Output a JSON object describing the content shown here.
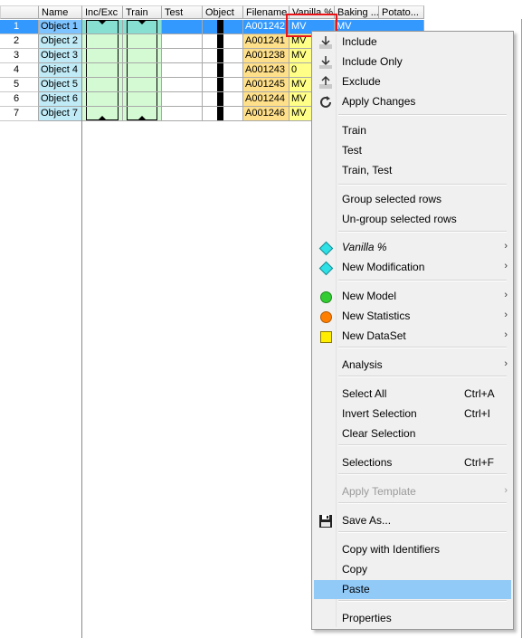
{
  "grid": {
    "headers": [
      "",
      "Name",
      "Inc/Exc",
      "Train",
      "Test",
      "Object",
      "Filename",
      "Vanilla %",
      "Baking ...",
      "Potato..."
    ],
    "rows": [
      {
        "num": "1",
        "name": "Object 1",
        "filename": "A001242",
        "vanilla": "MV"
      },
      {
        "num": "2",
        "name": "Object 2",
        "filename": "A001241",
        "vanilla": "MV"
      },
      {
        "num": "3",
        "name": "Object 3",
        "filename": "A001238",
        "vanilla": "MV"
      },
      {
        "num": "4",
        "name": "Object 4",
        "filename": "A001243",
        "vanilla": "0"
      },
      {
        "num": "5",
        "name": "Object 5",
        "filename": "A001245",
        "vanilla": "MV"
      },
      {
        "num": "6",
        "name": "Object 6",
        "filename": "A001244",
        "vanilla": "MV"
      },
      {
        "num": "7",
        "name": "Object 7",
        "filename": "A001246",
        "vanilla": "MV"
      }
    ],
    "selected_row": 1,
    "peek_text": "MV"
  },
  "menu": {
    "items": [
      {
        "label": "Include",
        "icon": "include-arrow-icon"
      },
      {
        "label": "Include Only",
        "icon": "include-only-arrow-icon"
      },
      {
        "label": "Exclude",
        "icon": "exclude-arrow-icon"
      },
      {
        "label": "Apply Changes",
        "icon": "refresh-icon"
      },
      {
        "label": "Train"
      },
      {
        "label": "Test"
      },
      {
        "label": "Train, Test"
      },
      {
        "label": "Group selected rows"
      },
      {
        "label": "Un-group selected rows"
      },
      {
        "label": "Vanilla %",
        "icon": "cyan-diamond-icon",
        "submenu": true
      },
      {
        "label": "New Modification",
        "icon": "cyan-diamond-icon",
        "submenu": true
      },
      {
        "label": "New Model",
        "icon": "green-circle-icon",
        "submenu": true
      },
      {
        "label": "New Statistics",
        "icon": "orange-circle-icon",
        "submenu": true
      },
      {
        "label": "New DataSet",
        "icon": "yellow-square-icon",
        "submenu": true
      },
      {
        "label": "Analysis",
        "submenu": true
      },
      {
        "label": "Select All",
        "shortcut": "Ctrl+A"
      },
      {
        "label": "Invert Selection",
        "shortcut": "Ctrl+I"
      },
      {
        "label": "Clear Selection"
      },
      {
        "label": "Selections",
        "shortcut": "Ctrl+F"
      },
      {
        "label": "Apply Template",
        "submenu": true,
        "disabled": true
      },
      {
        "label": "Save As...",
        "icon": "floppy-disk-icon"
      },
      {
        "label": "Copy with Identifiers"
      },
      {
        "label": "Copy"
      },
      {
        "label": "Paste",
        "highlighted": true
      },
      {
        "label": "Properties"
      }
    ],
    "submenu_arrow": "›",
    "colors": {
      "highlight": "#91c9f7",
      "selection_blue": "#3399ff",
      "callout_red": "#e8141a",
      "diamond": "#2de0e6",
      "model_green": "#33cc33",
      "stats_orange": "#ff7f00",
      "dataset_yellow": "#ffee00"
    }
  }
}
